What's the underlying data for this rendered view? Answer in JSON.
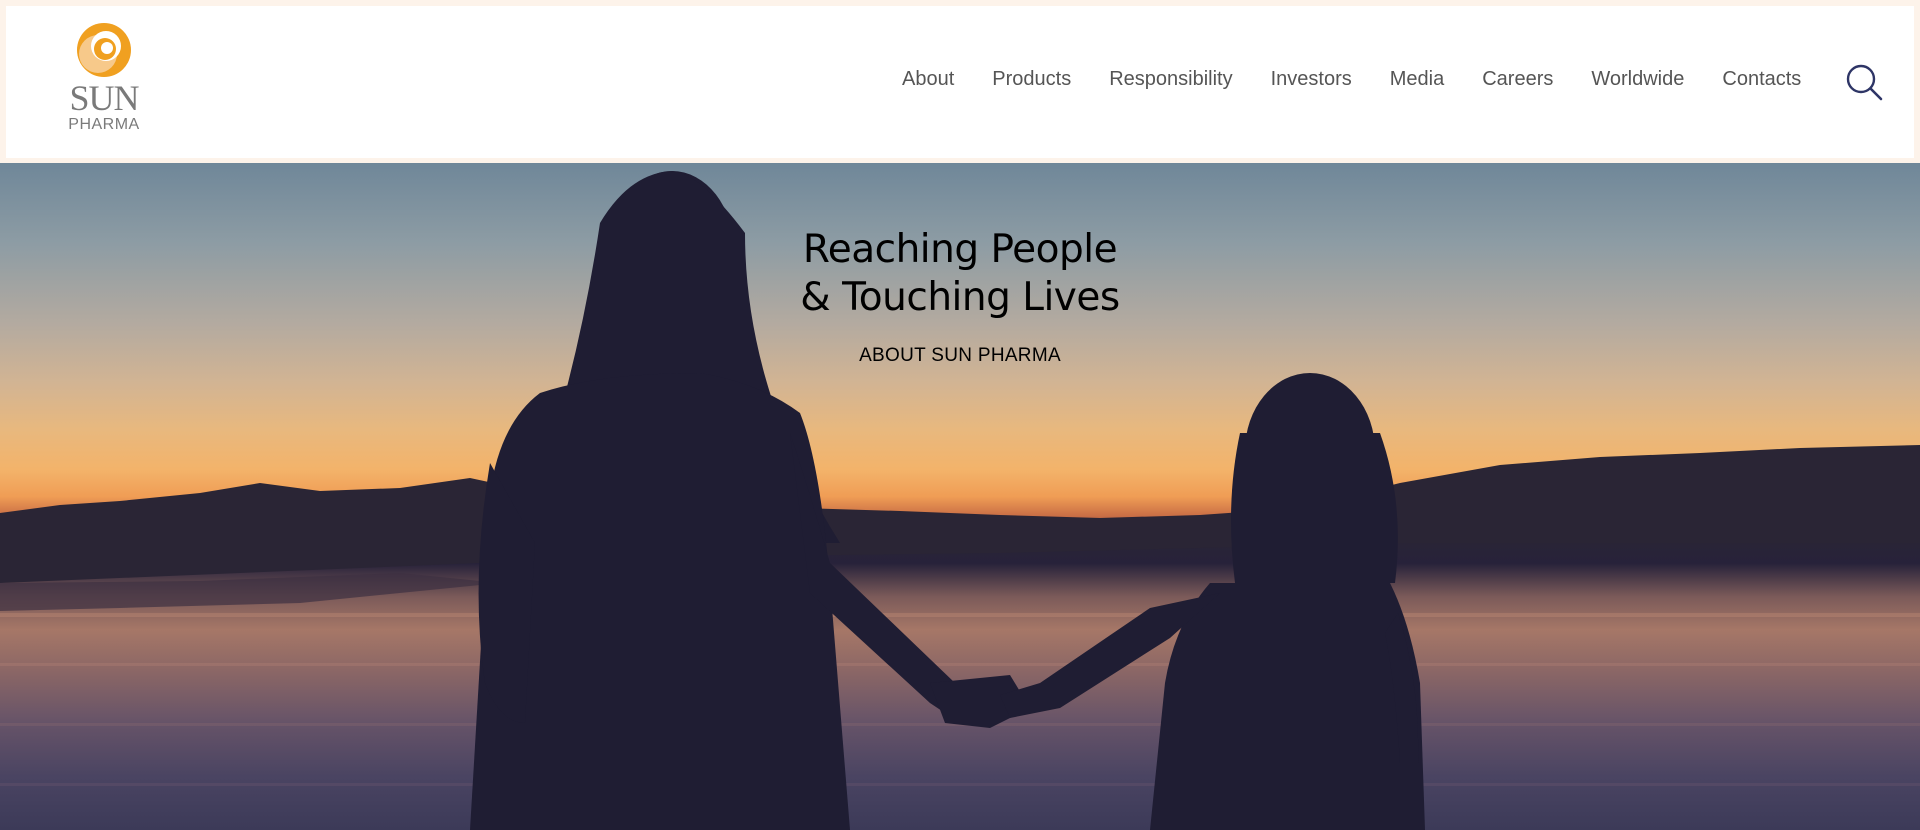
{
  "brand": {
    "logo_line1": "SUN",
    "logo_line2": "PHARMA"
  },
  "nav": {
    "items": [
      {
        "label": "About"
      },
      {
        "label": "Products"
      },
      {
        "label": "Responsibility"
      },
      {
        "label": "Investors"
      },
      {
        "label": "Media"
      },
      {
        "label": "Careers"
      },
      {
        "label": "Worldwide"
      },
      {
        "label": "Contacts"
      }
    ],
    "search_icon": "search-icon"
  },
  "hero": {
    "title_line1": "Reaching People",
    "title_line2": "& Touching Lives",
    "link_label": "ABOUT SUN PHARMA"
  },
  "colors": {
    "nav_text": "#555555",
    "logo_orange": "#f0a020",
    "logo_grey": "#7a7a7a",
    "search_icon": "#2e3566"
  }
}
